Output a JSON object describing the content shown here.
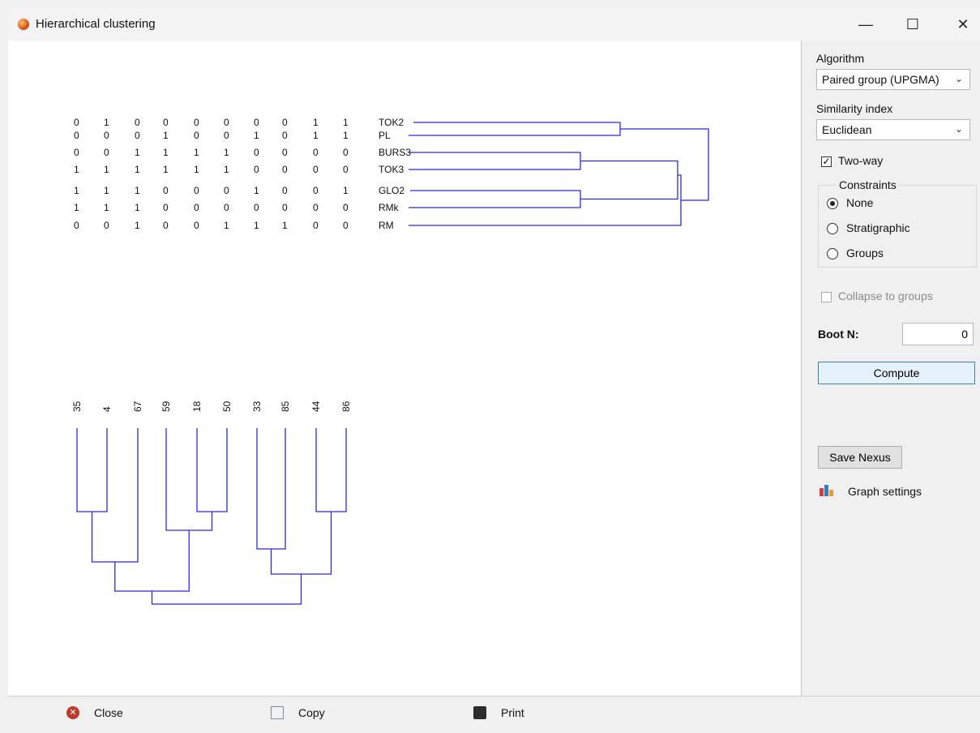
{
  "window": {
    "title": "Hierarchical clustering",
    "icon": "app-icon",
    "controls": {
      "minimize": "—",
      "maximize": "☐",
      "close": "✕"
    }
  },
  "side": {
    "algorithm_label": "Algorithm",
    "algorithm_value": "Paired group (UPGMA)",
    "similarity_label": "Similarity index",
    "similarity_value": "Euclidean",
    "two_way_label": "Two-way",
    "two_way_checked": true,
    "constraints_label": "Constraints",
    "constraints": [
      {
        "label": "None",
        "selected": true
      },
      {
        "label": "Stratigraphic",
        "selected": false
      },
      {
        "label": "Groups",
        "selected": false
      }
    ],
    "collapse_label": "Collapse to groups",
    "boot_label": "Boot N:",
    "boot_value": "0",
    "compute_label": "Compute",
    "save_nexus_label": "Save Nexus",
    "graph_settings_label": "Graph settings"
  },
  "bottom": {
    "close_label": "Close",
    "copy_label": "Copy",
    "print_label": "Print"
  },
  "matrix": {
    "row_labels": [
      "TOK2",
      "PL",
      "BURS3",
      "TOK3",
      "GLO2",
      "RMk",
      "RM"
    ],
    "rows": [
      [
        "0",
        "1",
        "0",
        "0",
        "0",
        "0",
        "0",
        "0",
        "1",
        "1"
      ],
      [
        "0",
        "0",
        "0",
        "1",
        "0",
        "0",
        "1",
        "0",
        "1",
        "1"
      ],
      [
        "0",
        "0",
        "1",
        "1",
        "1",
        "1",
        "0",
        "0",
        "0",
        "0"
      ],
      [
        "1",
        "1",
        "1",
        "1",
        "1",
        "1",
        "0",
        "0",
        "0",
        "0"
      ],
      [
        "1",
        "1",
        "1",
        "0",
        "0",
        "0",
        "1",
        "0",
        "0",
        "1"
      ],
      [
        "1",
        "1",
        "1",
        "0",
        "0",
        "0",
        "0",
        "0",
        "0",
        "0"
      ],
      [
        "0",
        "0",
        "1",
        "0",
        "0",
        "1",
        "1",
        "1",
        "0",
        "0"
      ]
    ],
    "column_labels": [
      "35",
      "4",
      "67",
      "59",
      "18",
      "50",
      "33",
      "85",
      "44",
      "86"
    ]
  },
  "colors": {
    "dendrogram": "#2b2bd6",
    "accent": "#3c7fb1"
  }
}
